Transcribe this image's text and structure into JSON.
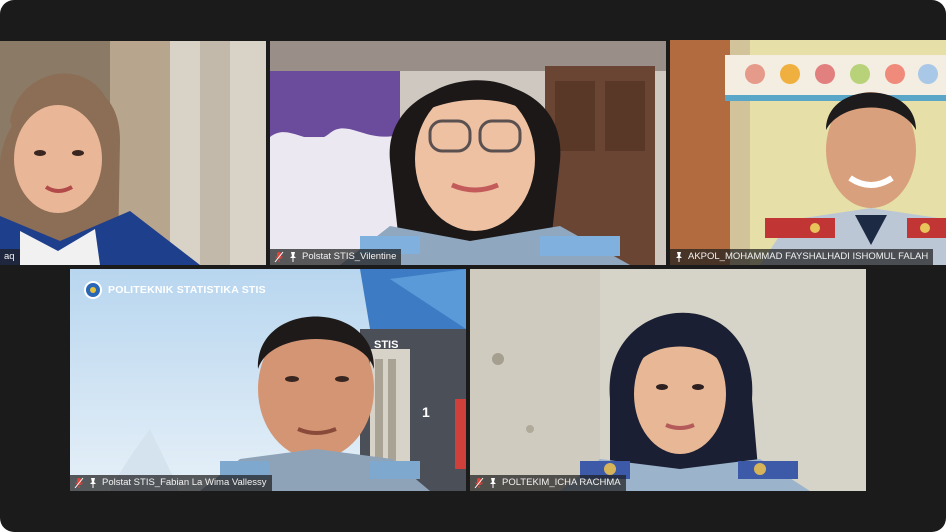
{
  "participants": [
    {
      "name": "aq",
      "muted": false,
      "pinned": false,
      "speaking": false
    },
    {
      "name": "Polstat STIS_Vilentine",
      "muted": true,
      "pinned": true,
      "speaking": false
    },
    {
      "name": "AKPOL_MOHAMMAD FAYSHALHADI ISHOMUL FALAH",
      "muted": false,
      "pinned": true,
      "speaking": true
    },
    {
      "name": "Polstat STIS_Fabian La Wima Vallessy",
      "muted": true,
      "pinned": true,
      "speaking": false
    },
    {
      "name": "POLTEKIM_ICHA RACHMA",
      "muted": true,
      "pinned": true,
      "speaking": false
    }
  ],
  "background_banner": {
    "text": "POLITEKNIK STATISTIKA STIS"
  },
  "wall_sign": {
    "text": "STIS",
    "number": "1"
  },
  "colors": {
    "active_speaker_border": "#c6e34a",
    "stage_bg": "#1b1b1b",
    "muted_mic": "#e0443a"
  },
  "icons": [
    "muted-mic-icon",
    "pin-icon"
  ]
}
